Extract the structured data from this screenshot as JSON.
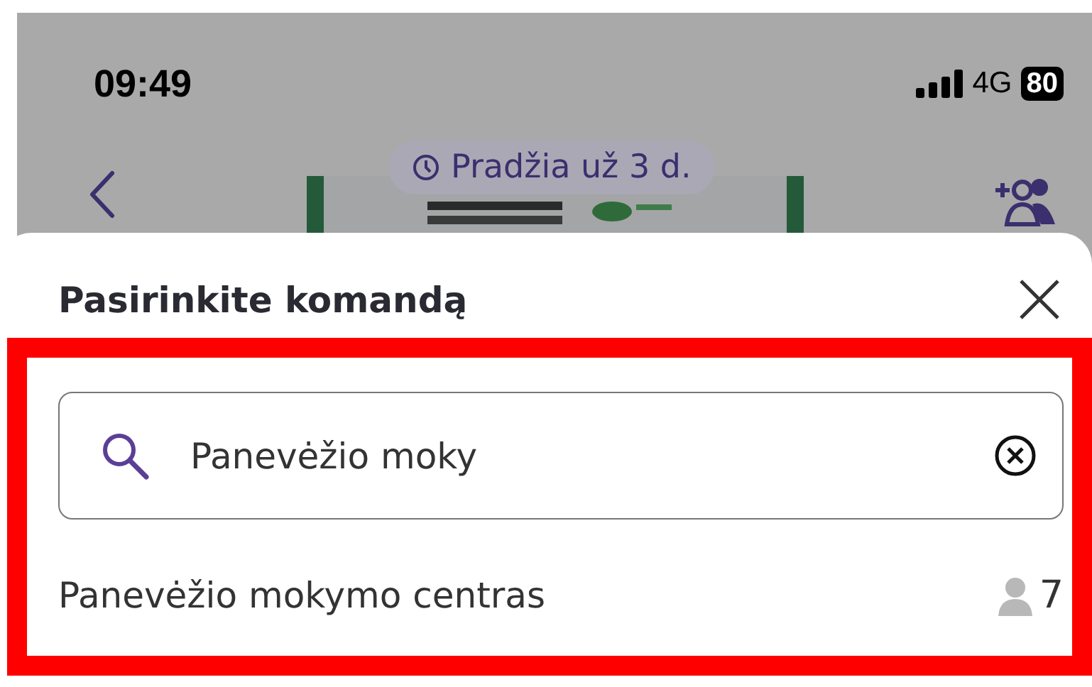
{
  "status_bar": {
    "time": "09:49",
    "network": "4G",
    "battery": "80"
  },
  "header": {
    "badge": "Pradžia už 3 d."
  },
  "sheet": {
    "title": "Pasirinkite komandą",
    "search": {
      "value": "Panevėžio moky"
    },
    "results": [
      {
        "name": "Panevėžio mokymo centras",
        "members": "7"
      }
    ]
  }
}
